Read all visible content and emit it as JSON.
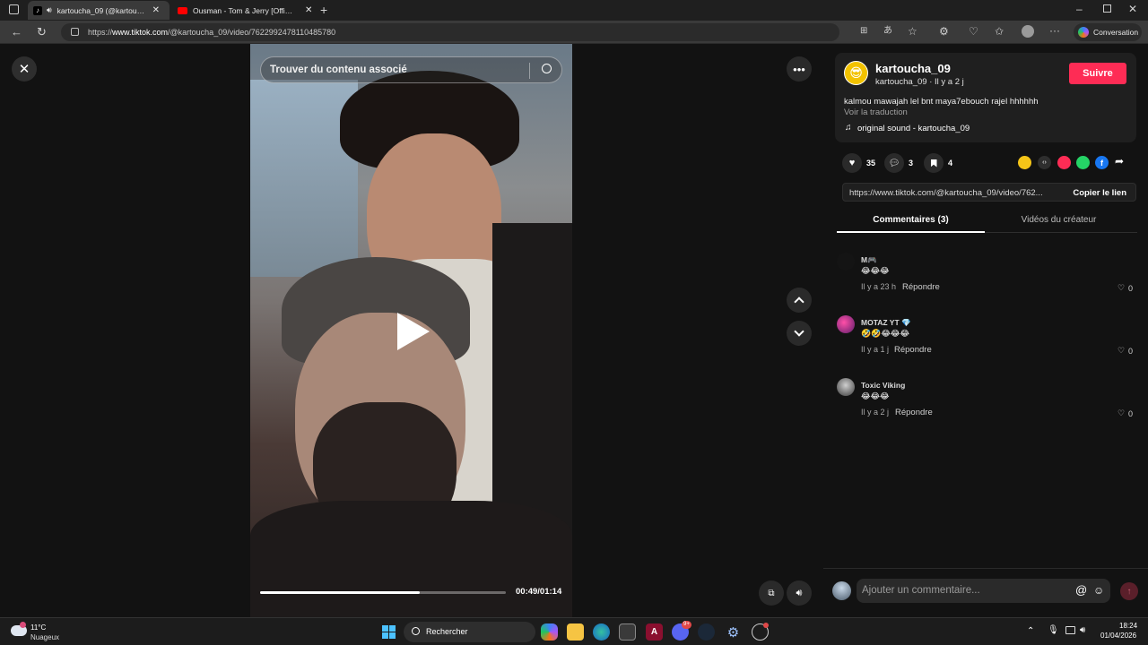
{
  "browser": {
    "tabs": [
      {
        "title": "kartoucha_09 (@kartoucha_...",
        "active": true
      },
      {
        "title": "Ousman - Tom & Jerry [Official Vi...",
        "active": false
      }
    ],
    "url_prefix": "https://",
    "url_host": "www.tiktok.com",
    "url_path": "/@kartoucha_09/video/7622992478110485780",
    "conversation_label": "Conversation"
  },
  "video": {
    "search_placeholder": "Trouver du contenu associé",
    "time": "00:49/01:14",
    "progress": 0.65
  },
  "author": {
    "username": "kartoucha_09",
    "subtitle": "kartoucha_09 · Il y a 2 j",
    "follow_label": "Suivre",
    "caption": "kalmou mawajah lel bnt maya7ebouch rajel hhhhhh",
    "translate_label": "Voir la traduction",
    "sound": "original sound - kartoucha_09"
  },
  "stats": {
    "likes": "35",
    "comments": "3",
    "saves": "4"
  },
  "link": {
    "url": "https://www.tiktok.com/@kartoucha_09/video/762...",
    "copy_label": "Copier le lien"
  },
  "tabs": {
    "comments": "Commentaires (3)",
    "creator_videos": "Vidéos du créateur"
  },
  "comments": [
    {
      "name": "M🎮",
      "text": "😂😂😂",
      "time": "Il y a 23 h",
      "reply": "Répondre",
      "likes": "0"
    },
    {
      "name": "MOTAZ YT 💎",
      "text": "🤣🤣😂😂😂",
      "time": "Il y a 1 j",
      "reply": "Répondre",
      "likes": "0"
    },
    {
      "name": "Toxic Viking",
      "text": "😂😂😂",
      "time": "Il y a 2 j",
      "reply": "Répondre",
      "likes": "0"
    }
  ],
  "comment_input": {
    "placeholder": "Ajouter un commentaire..."
  },
  "taskbar": {
    "weather_temp": "11°C",
    "weather_desc": "Nuageux",
    "search_label": "Rechercher",
    "time": "18:24",
    "date": "01/04/2026",
    "discord_badge": "9+"
  },
  "colors": {
    "accent": "#fe2c55",
    "panel": "#121212",
    "card": "#1f1f1f"
  }
}
